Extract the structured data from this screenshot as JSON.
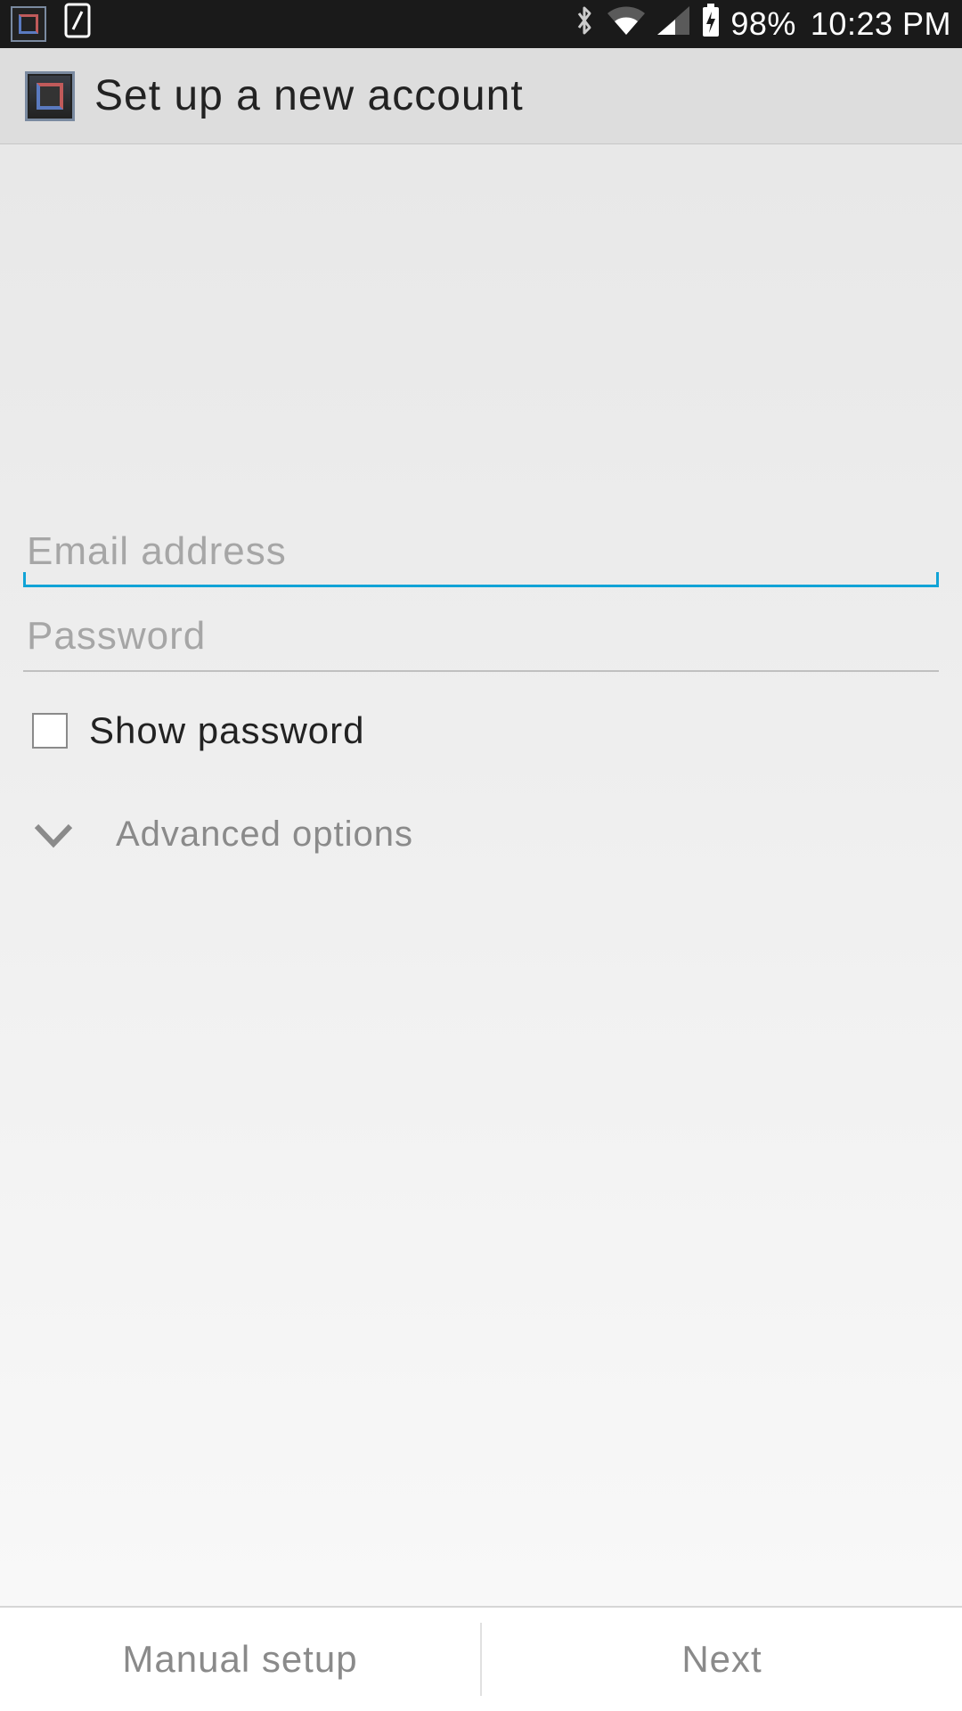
{
  "status_bar": {
    "battery_percent": "98%",
    "time": "10:23 PM"
  },
  "header": {
    "title": "Set up a new account"
  },
  "form": {
    "email": {
      "placeholder": "Email address",
      "value": ""
    },
    "password": {
      "placeholder": "Password",
      "value": ""
    },
    "show_password_label": "Show password",
    "show_password_checked": false,
    "advanced_label": "Advanced options"
  },
  "footer": {
    "manual_setup": "Manual setup",
    "next": "Next"
  }
}
